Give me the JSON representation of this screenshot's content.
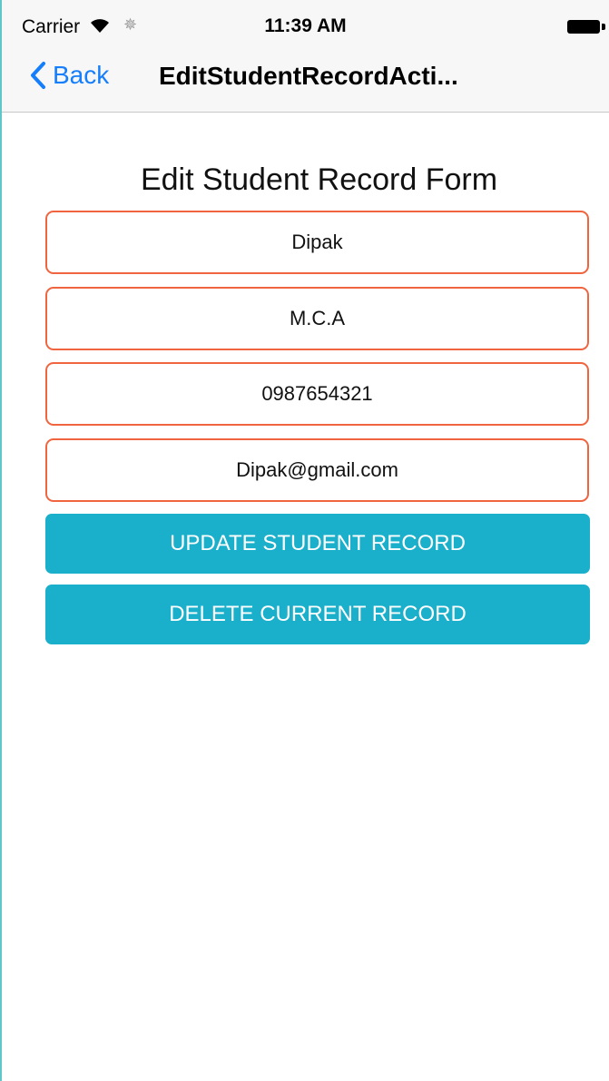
{
  "status_bar": {
    "carrier": "Carrier",
    "time": "11:39 AM",
    "wifi_icon": "wifi-icon",
    "activity_icon": "activity-spinner-icon",
    "battery_icon": "battery-icon"
  },
  "nav": {
    "back_label": "Back",
    "back_icon": "chevron-left-icon",
    "title": "EditStudentRecordActi..."
  },
  "form": {
    "title": "Edit Student Record Form",
    "fields": [
      {
        "value": "Dipak"
      },
      {
        "value": "M.C.A"
      },
      {
        "value": "0987654321"
      },
      {
        "value": "Dipak@gmail.com"
      }
    ],
    "update_label": "UPDATE STUDENT RECORD",
    "delete_label": "DELETE CURRENT RECORD"
  },
  "colors": {
    "accent_blue": "#157efb",
    "button_teal": "#1aafca",
    "field_border": "#f0643f"
  }
}
